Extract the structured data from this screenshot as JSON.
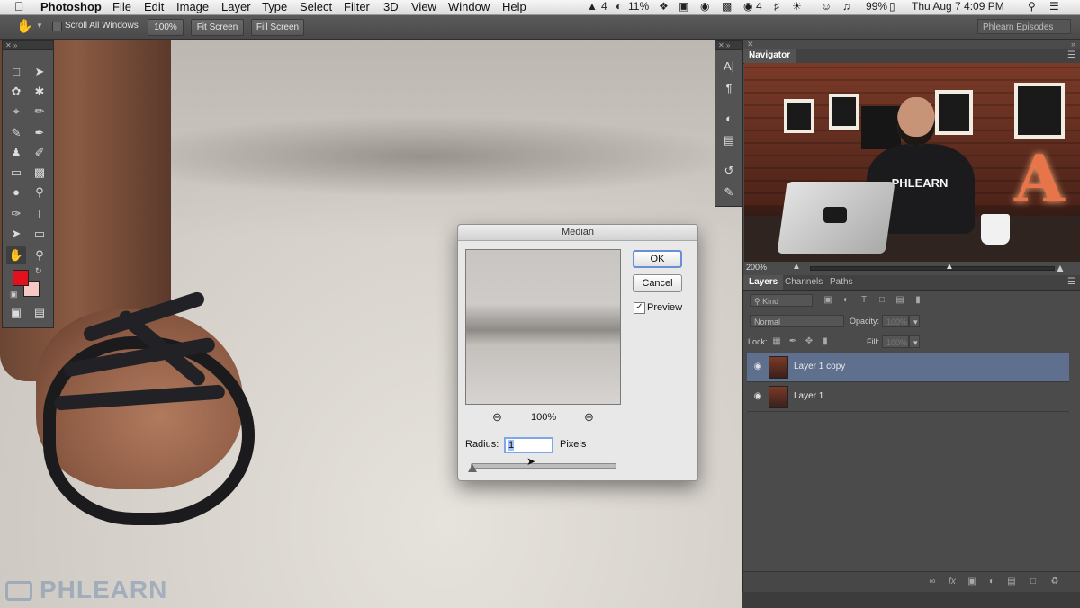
{
  "menubar": {
    "app": "Photoshop",
    "menus": [
      "File",
      "Edit",
      "Image",
      "Layer",
      "Type",
      "Select",
      "Filter",
      "3D",
      "View",
      "Window",
      "Help"
    ],
    "status": {
      "adobe_badge": "4",
      "sync_percent": "11%",
      "notify_count": "4",
      "battery": "99%",
      "datetime": "Thu Aug 7  4:09 PM"
    }
  },
  "options_bar": {
    "scroll_all_windows": "Scroll All Windows",
    "zoom_100": "100%",
    "fit_screen": "Fit Screen",
    "fill_screen": "Fill Screen",
    "workspace": "Phlearn Episodes"
  },
  "canvas": {
    "watermark": "PHLEARN"
  },
  "navigator": {
    "title": "Navigator",
    "zoom": "200%",
    "shirt_text": "PHLEARN",
    "sign_letter": "A"
  },
  "layers_panel": {
    "tabs": [
      "Layers",
      "Channels",
      "Paths"
    ],
    "filter_kind": "Kind",
    "blend_mode": "Normal",
    "opacity_label": "Opacity:",
    "opacity_value": "100%",
    "lock_label": "Lock:",
    "fill_label": "Fill:",
    "fill_value": "100%",
    "layers": [
      {
        "name": "Layer 1 copy",
        "selected": true
      },
      {
        "name": "Layer 1",
        "selected": false
      }
    ]
  },
  "median_dialog": {
    "title": "Median",
    "ok": "OK",
    "cancel": "Cancel",
    "preview_label": "Preview",
    "preview_checked": true,
    "zoom": "100%",
    "radius_label": "Radius:",
    "radius_value": "1",
    "unit": "Pixels"
  },
  "colors": {
    "foreground": "#e3101d",
    "background": "#f6c8c4",
    "layer_selected": "#5f6f8e",
    "dialog_focus": "#7ea7e8"
  }
}
